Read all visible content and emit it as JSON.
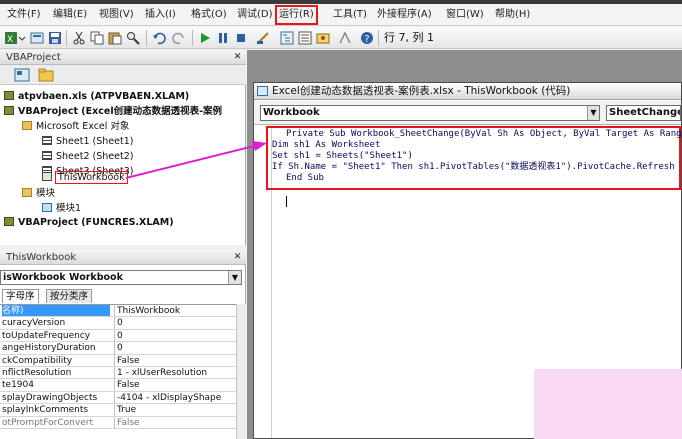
{
  "menu": {
    "items": [
      "文件(F)",
      "编辑(E)",
      "视图(V)",
      "插入(I)",
      "格式(O)",
      "调试(D)",
      "运行(R)",
      "工具(T)",
      "外接程序(A)",
      "窗口(W)",
      "帮助(H)"
    ]
  },
  "toolbar": {
    "position_readout": "行 7, 列 1"
  },
  "project": {
    "title": "VBAProject",
    "nodes": [
      {
        "label": "atpvbaen.xls (ATPVBAEN.XLAM)",
        "bold": true
      },
      {
        "label": "VBAProject (Excel创建动态数据透视表-案例",
        "bold": true
      },
      {
        "label": "Microsoft Excel 对象",
        "bold": false
      },
      {
        "label": "Sheet1 (Sheet1)",
        "bold": false
      },
      {
        "label": "Sheet2 (Sheet2)",
        "bold": false
      },
      {
        "label": "Sheet3 (Sheet3)",
        "bold": false
      },
      {
        "label": "ThisWorkbook",
        "bold": false
      },
      {
        "label": "模块",
        "bold": false
      },
      {
        "label": "模块1",
        "bold": false
      },
      {
        "label": "VBAProject (FUNCRES.XLAM)",
        "bold": true
      }
    ]
  },
  "properties": {
    "title": "ThisWorkbook",
    "object_selector": "isWorkbook Workbook",
    "tabs": [
      "字母序",
      "按分类序"
    ],
    "rows": [
      {
        "name": "名称)",
        "value": "ThisWorkbook"
      },
      {
        "name": "curacyVersion",
        "value": "0"
      },
      {
        "name": "toUpdateFrequency",
        "value": "0"
      },
      {
        "name": "angeHistoryDuration",
        "value": "0"
      },
      {
        "name": "ckCompatibility",
        "value": "False"
      },
      {
        "name": "nflictResolution",
        "value": "1 - xlUserResolution"
      },
      {
        "name": "te1904",
        "value": "False"
      },
      {
        "name": "splayDrawingObjects",
        "value": "-4104 - xlDisplayShape"
      },
      {
        "name": "splayInkComments",
        "value": "True"
      },
      {
        "name": "otPromptForConvert",
        "value": "False"
      }
    ]
  },
  "code_window": {
    "title": "Excel创建动态数据透视表-案例表.xlsx - ThisWorkbook (代码)",
    "object_combo": "Workbook",
    "procedure_combo": "SheetChange",
    "lines": [
      "Private Sub Workbook_SheetChange(ByVal Sh As Object, ByVal Target As Range)",
      "Dim sh1 As Worksheet",
      "Set sh1 = Sheets(\"Sheet1\")",
      "If Sh.Name = \"Sheet1\" Then sh1.PivotTables(\"数据透视表1\").PivotCache.Refresh",
      "End Sub"
    ]
  },
  "colors": {
    "highlight_red": "#e8141e",
    "arrow_magenta": "#e21bd2",
    "selection_blue": "#3399ff",
    "pink_overlay": "#f7d9f1"
  },
  "icons": [
    "save-icon",
    "cut-icon",
    "copy-icon",
    "paste-icon",
    "find-icon",
    "undo-icon",
    "redo-icon",
    "run-icon",
    "break-icon",
    "reset-icon",
    "design-mode-icon",
    "project-explorer-icon",
    "properties-icon",
    "object-browser-icon",
    "toolbox-icon",
    "help-icon"
  ]
}
